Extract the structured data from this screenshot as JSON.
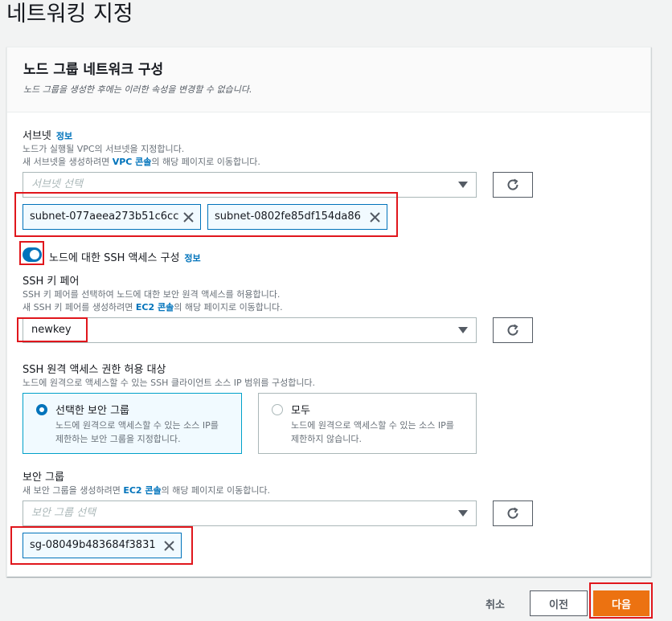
{
  "page": {
    "title": "네트워킹 지정"
  },
  "panel": {
    "title": "노드 그룹 네트워크 구성",
    "description": "노드 그룹을 생성한 후에는 이러한 속성을 변경할 수 없습니다."
  },
  "subnet": {
    "label": "서브넷",
    "info": "정보",
    "desc_line1": "노드가 실행될 VPC의 서브넷을 지정합니다.",
    "desc_line2_prefix": "새 서브넷을 생성하려면 ",
    "desc_line2_link": "VPC 콘솔",
    "desc_line2_suffix": "의 해당 페이지로 이동합니다.",
    "placeholder": "서브넷 선택",
    "tokens": [
      "subnet-077aeea273b51c6cc",
      "subnet-0802fe85df154da86"
    ]
  },
  "ssh_toggle": {
    "label": "노드에 대한 SSH 액세스 구성",
    "info": "정보",
    "enabled": true
  },
  "ssh_key": {
    "label": "SSH 키 페어",
    "desc_line1": "SSH 키 페어를 선택하여 노드에 대한 보안 원격 액세스를 허용합니다.",
    "desc_line2_prefix": "새 SSH 키 페어를 생성하려면 ",
    "desc_line2_link": "EC2 콘솔",
    "desc_line2_suffix": "의 해당 페이지로 이동합니다.",
    "value": "newkey"
  },
  "ssh_access": {
    "label": "SSH 원격 액세스 권한 허용 대상",
    "desc": "노드에 원격으로 액세스할 수 있는 SSH 클라이언트 소스 IP 범위를 구성합니다.",
    "options": [
      {
        "title": "선택한 보안 그룹",
        "desc": "노드에 원격으로 액세스할 수 있는 소스 IP를 제한하는 보안 그룹을 지정합니다.",
        "selected": true
      },
      {
        "title": "모두",
        "desc": "노드에 원격으로 액세스할 수 있는 소스 IP를 제한하지 않습니다.",
        "selected": false
      }
    ]
  },
  "security_group": {
    "label": "보안 그룹",
    "desc_prefix": "새 보안 그룹을 생성하려면 ",
    "desc_link": "EC2 콘솔",
    "desc_suffix": "의 해당 페이지로 이동합니다.",
    "placeholder": "보안 그룹 선택",
    "tokens": [
      "sg-08049b483684f3831"
    ]
  },
  "footer": {
    "cancel": "취소",
    "previous": "이전",
    "next": "다음"
  },
  "colors": {
    "accent": "#0073bb",
    "primary_button": "#ec7211",
    "highlight": "#e0161c"
  }
}
